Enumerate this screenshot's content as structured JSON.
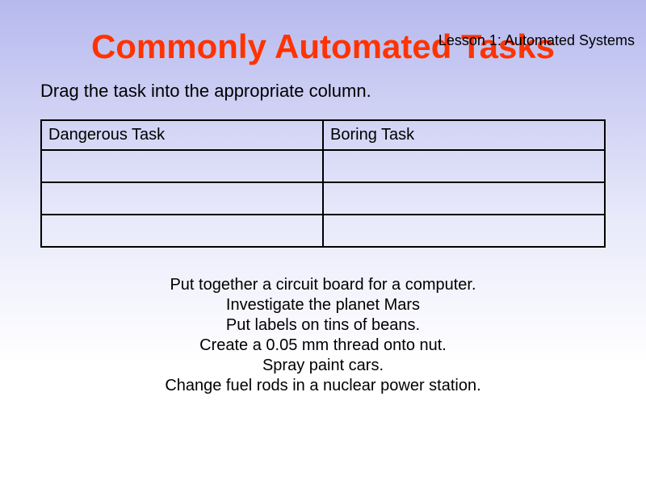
{
  "lesson_label": "Lesson 1:  Automated Systems",
  "title": "Commonly Automated Tasks",
  "instruction": "Drag the task into the appropriate column.",
  "table": {
    "headers": [
      "Dangerous Task",
      "Boring Task"
    ],
    "rows": [
      [
        "",
        ""
      ],
      [
        "",
        ""
      ],
      [
        "",
        ""
      ]
    ]
  },
  "tasks": [
    "Put together a circuit board for a computer.",
    "Investigate the planet Mars",
    "Put labels on tins of beans.",
    "Create a 0.05 mm thread onto nut.",
    "Spray paint cars.",
    "Change fuel rods in a nuclear power station."
  ]
}
